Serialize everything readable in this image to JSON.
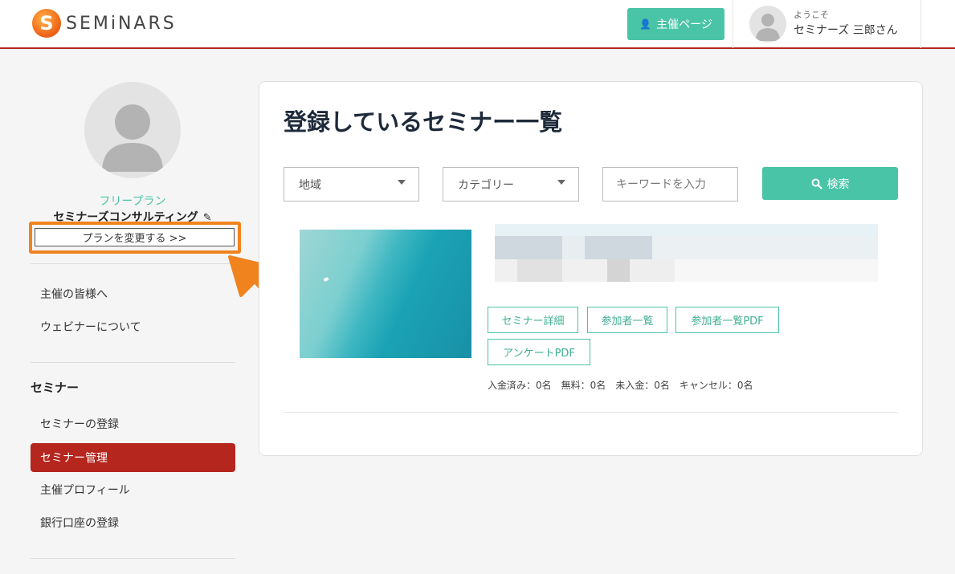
{
  "header": {
    "logo_letter": "S",
    "logo_text": "SEMiNARS",
    "host_page_label": "主催ページ",
    "welcome_label": "ようこそ",
    "user_name": "セミナーズ 三郎さん"
  },
  "sidebar": {
    "plan_label": "フリープラン",
    "org_name": "セミナーズコンサルティング",
    "change_plan_label": "プランを変更する >>",
    "links": [
      {
        "label": "主催の皆様へ"
      },
      {
        "label": "ウェビナーについて"
      }
    ],
    "section_title": "セミナー",
    "items": [
      {
        "label": "セミナーの登録"
      },
      {
        "label": "セミナー管理",
        "active": true
      },
      {
        "label": "主催プロフィール"
      },
      {
        "label": "銀行口座の登録"
      }
    ]
  },
  "main": {
    "title": "登録しているセミナー一覧",
    "filters": {
      "region_label": "地域",
      "category_label": "カテゴリー",
      "keyword_placeholder": "キーワードを入力",
      "search_label": "検索"
    },
    "seminar": {
      "buttons": [
        "セミナー詳細",
        "参加者一覧",
        "参加者一覧PDF",
        "アンケートPDF"
      ],
      "stats": "入金済み：0名　無料：0名　未入金：0名　キャンセル：0名"
    }
  },
  "colors": {
    "brand_red": "#b5261e",
    "accent_green": "#4ac4a6",
    "highlight_orange": "#f0831e"
  }
}
